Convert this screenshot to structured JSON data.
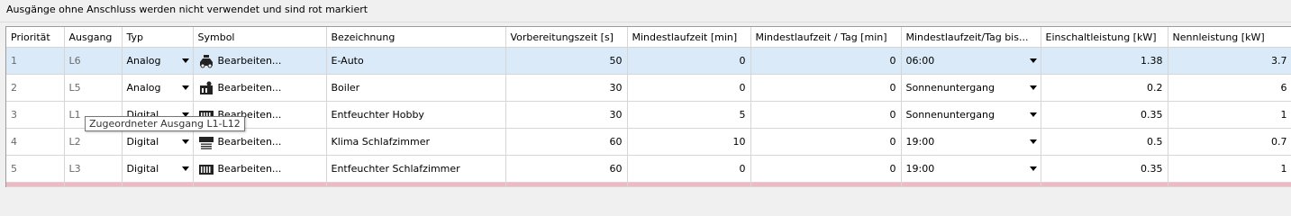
{
  "notice": "Ausgänge ohne Anschluss werden nicht verwendet und sind rot markiert",
  "columns": [
    "Priorität",
    "Ausgang",
    "Typ",
    "Symbol",
    "Bezeichnung",
    "Vorbereitungszeit [s]",
    "Mindestlaufzeit [min]",
    "Mindestlaufzeit / Tag [min]",
    "Mindestlaufzeit/Tag bis...",
    "Einschaltleistung [kW]",
    "Nennleistung [kW]"
  ],
  "rows": [
    {
      "prio": "1",
      "ausgang": "L6",
      "typ": "Analog",
      "icon": "car-icon",
      "symbol": "Bearbeiten...",
      "bezeichnung": "E-Auto",
      "vorb": "50",
      "mind": "0",
      "mind_tag": "0",
      "bis": "06:00",
      "einschalt": "1.38",
      "nenn": "3.7",
      "selected": true
    },
    {
      "prio": "2",
      "ausgang": "L5",
      "typ": "Analog",
      "icon": "boiler-icon",
      "symbol": "Bearbeiten...",
      "bezeichnung": "Boiler",
      "vorb": "30",
      "mind": "0",
      "mind_tag": "0",
      "bis": "Sonnenuntergang",
      "einschalt": "0.2",
      "nenn": "6"
    },
    {
      "prio": "3",
      "ausgang": "L1",
      "typ": "Digital",
      "icon": "dehumidifier-icon",
      "symbol": "Bearbeiten...",
      "bezeichnung": "Entfeuchter Hobby",
      "vorb": "30",
      "mind": "5",
      "mind_tag": "0",
      "bis": "Sonnenuntergang",
      "einschalt": "0.35",
      "nenn": "1"
    },
    {
      "prio": "4",
      "ausgang": "L2",
      "typ": "Digital",
      "icon": "air-conditioner-icon",
      "symbol": "Bearbeiten...",
      "bezeichnung": "Klima Schlafzimmer",
      "vorb": "60",
      "mind": "10",
      "mind_tag": "0",
      "bis": "19:00",
      "einschalt": "0.5",
      "nenn": "0.7"
    },
    {
      "prio": "5",
      "ausgang": "L3",
      "typ": "Digital",
      "icon": "dehumidifier-icon",
      "symbol": "Bearbeiten...",
      "bezeichnung": "Entfeuchter Schlafzimmer",
      "vorb": "60",
      "mind": "0",
      "mind_tag": "0",
      "bis": "19:00",
      "einschalt": "0.35",
      "nenn": "1"
    }
  ],
  "tooltip": "Zugeordneter Ausgang L1-L12"
}
